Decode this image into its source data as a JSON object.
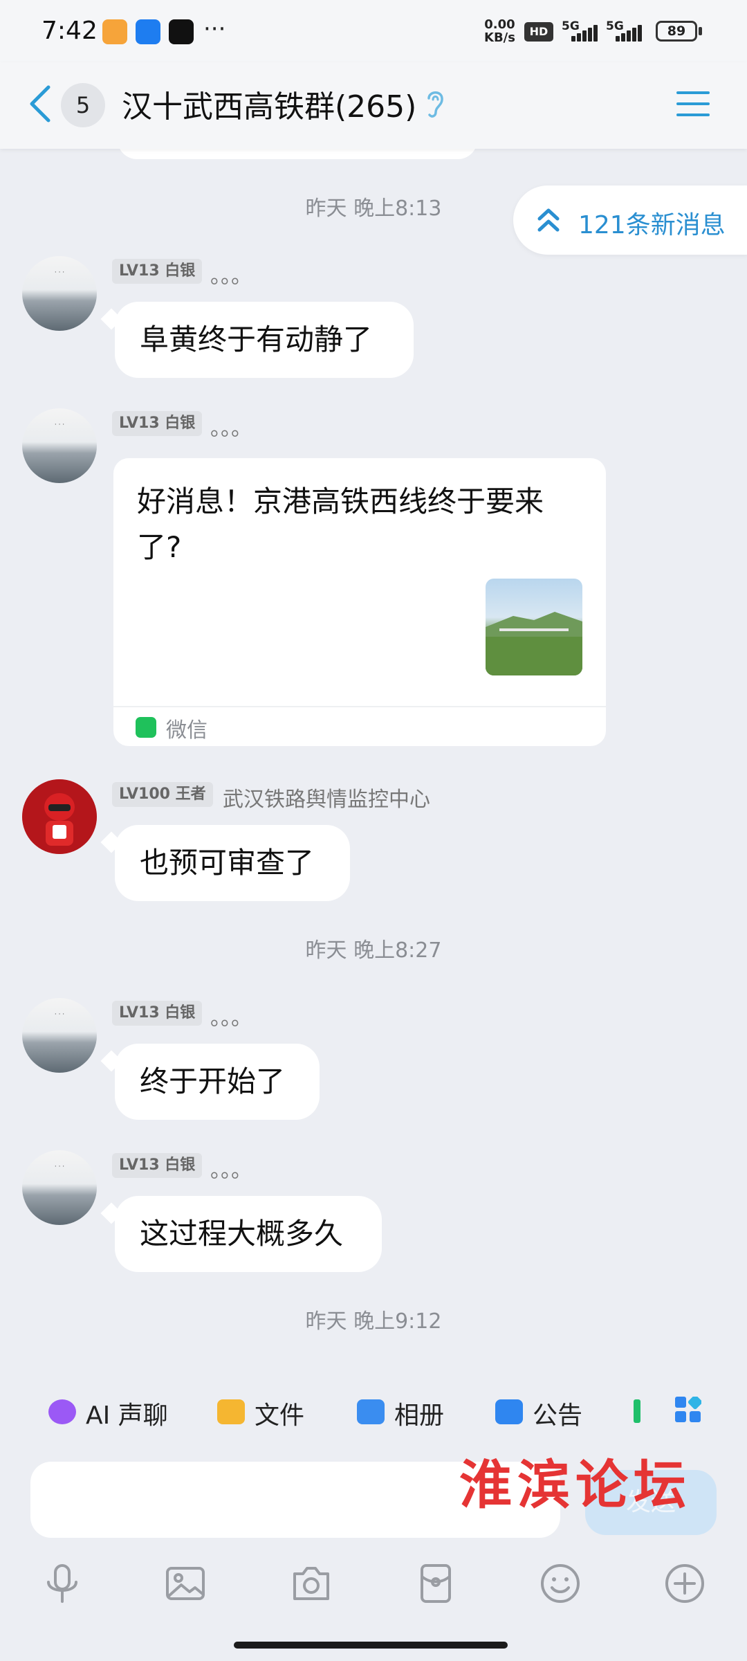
{
  "status_bar": {
    "time": "7:42",
    "more": "···",
    "net_speed_value": "0.00",
    "net_speed_unit": "KB/s",
    "hd": "HD",
    "net1": "5G",
    "net2": "5G",
    "battery": "89"
  },
  "header": {
    "unread_count": "5",
    "title": "汉十武西高铁群(265)"
  },
  "new_messages": "121条新消息",
  "timestamps": [
    "昨天 晚上8:13",
    "昨天 晚上8:27",
    "昨天 晚上9:12"
  ],
  "messages": [
    {
      "level": "LV13 白银",
      "nickname": "。。。",
      "text": "阜黄终于有动静了"
    },
    {
      "level": "LV13 白银",
      "nickname": "。。。",
      "card_title": "好消息！京港高铁西线终于要来了?",
      "card_source": "微信"
    },
    {
      "level": "LV100 王者",
      "nickname": "武汉铁路舆情监控中心",
      "text": "也预可审查了"
    },
    {
      "level": "LV13 白银",
      "nickname": "。。。",
      "text": "终于开始了"
    },
    {
      "level": "LV13 白银",
      "nickname": "。。。",
      "text": "这过程大概多久"
    }
  ],
  "quick_actions": [
    {
      "label": "AI 声聊",
      "color": "#9b59f5"
    },
    {
      "label": "文件",
      "color": "#f5b631"
    },
    {
      "label": "相册",
      "color": "#3a8df0"
    },
    {
      "label": "公告",
      "color": "#2f86f0"
    }
  ],
  "input": {
    "placeholder": "",
    "send_label": "发送"
  },
  "watermark": "淮滨论坛",
  "colors": {
    "accent": "#2a9bd6",
    "background": "#eceef3",
    "bubble": "#ffffff"
  }
}
